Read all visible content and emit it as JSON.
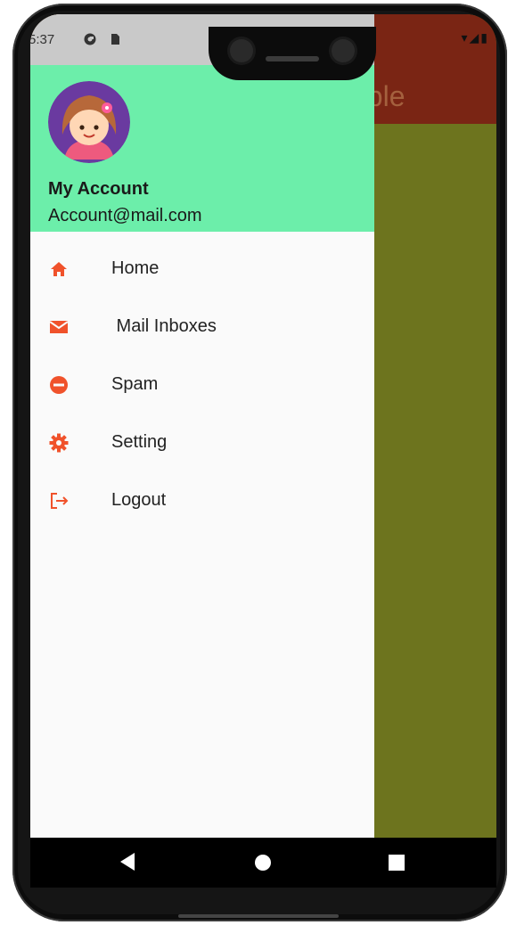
{
  "status_bar": {
    "time": "5:37"
  },
  "app": {
    "title_fragment": "nple"
  },
  "drawer": {
    "account_name": "My Account",
    "account_email": "Account@mail.com",
    "items": [
      {
        "label": "Home",
        "icon": "home-icon"
      },
      {
        "label": " Mail Inboxes",
        "icon": "mail-icon"
      },
      {
        "label": "Spam",
        "icon": "spam-icon"
      },
      {
        "label": "Setting",
        "icon": "settings-gear-icon"
      },
      {
        "label": "Logout",
        "icon": "logout-icon"
      }
    ]
  },
  "colors": {
    "header_bg": "#6ceeaa",
    "icon_accent": "#f0522b",
    "app_bar": "#7a2514",
    "app_body": "#6d741e"
  }
}
